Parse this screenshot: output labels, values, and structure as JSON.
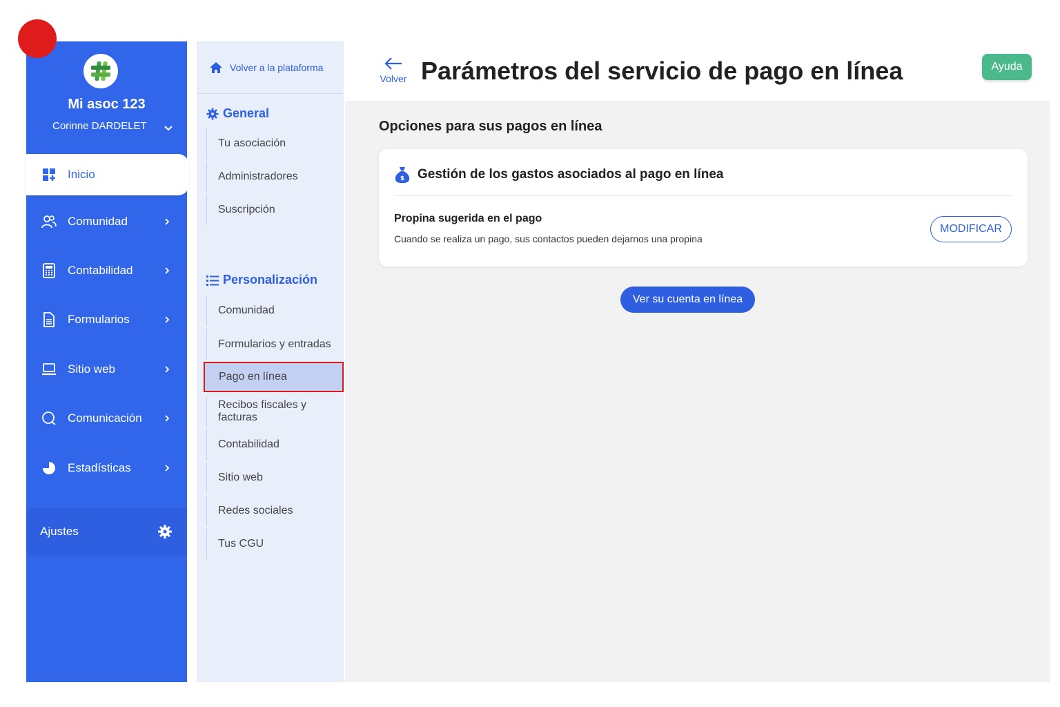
{
  "sidebar": {
    "org_name": "Mi asoc 123",
    "user_name": "Corinne DARDELET",
    "items": [
      {
        "label": "Inicio",
        "icon": "dashboard-icon"
      },
      {
        "label": "Comunidad",
        "icon": "users-icon"
      },
      {
        "label": "Contabilidad",
        "icon": "calculator-icon"
      },
      {
        "label": "Formularios",
        "icon": "document-icon"
      },
      {
        "label": "Sitio web",
        "icon": "laptop-icon"
      },
      {
        "label": "Comunicación",
        "icon": "chat-icon"
      },
      {
        "label": "Estadísticas",
        "icon": "pie-chart-icon"
      }
    ],
    "settings_label": "Ajustes"
  },
  "subnav": {
    "back_label": "Volver a la plataforma",
    "general": {
      "title": "General",
      "items": [
        "Tu asociación",
        "Administradores",
        "Suscripción"
      ]
    },
    "personalization": {
      "title": "Personalización",
      "items": [
        "Comunidad",
        "Formularios y entradas",
        "Pago en línea",
        "Recibos fiscales y facturas",
        "Contabilidad",
        "Sitio web",
        "Redes sociales",
        "Tus CGU"
      ],
      "selected": "Pago en línea"
    }
  },
  "header": {
    "back_label": "Volver",
    "title": "Parámetros del servicio de pago en línea",
    "help_label": "Ayuda"
  },
  "main": {
    "section_title": "Opciones para sus pagos en línea",
    "card": {
      "title": "Gestión de los gastos asociados al pago en línea",
      "tip_title": "Propina sugerida en el pago",
      "tip_desc": "Cuando se realiza un pago, sus contactos pueden dejarnos una propina",
      "modify_label": "MODIFICAR"
    },
    "account_button": "Ver su cuenta en línea"
  },
  "colors": {
    "primary": "#3166ea",
    "help": "#4cb98c",
    "highlight": "#d71a1a"
  }
}
